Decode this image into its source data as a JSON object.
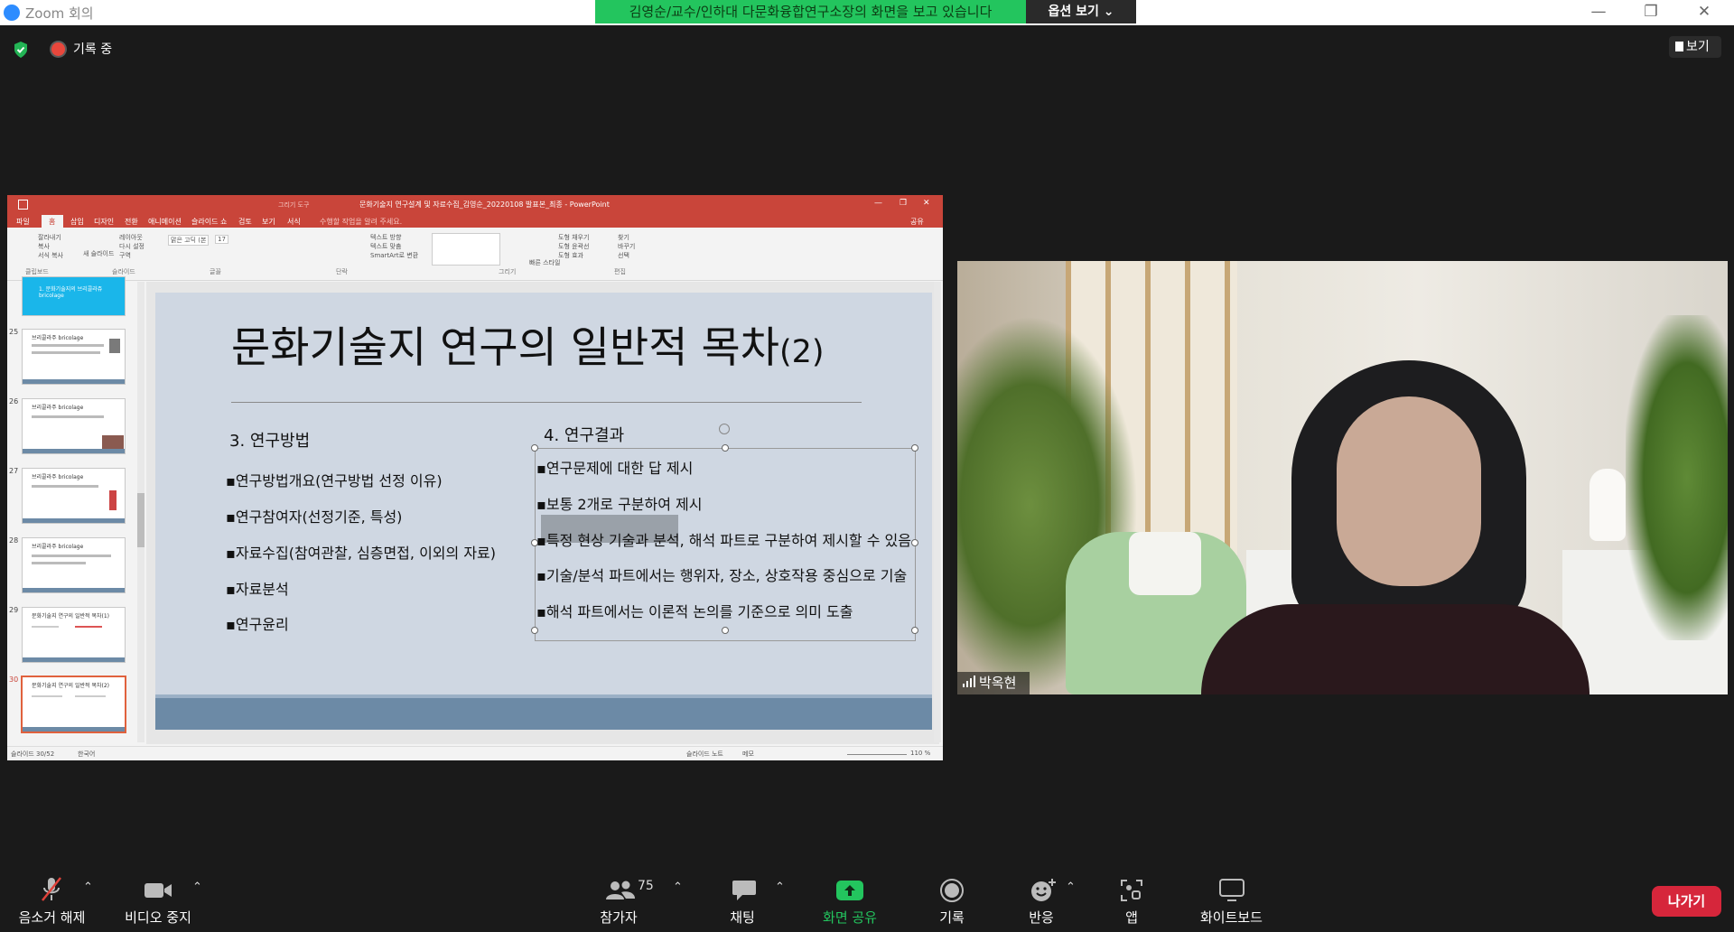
{
  "window": {
    "app_title": "Zoom 회의",
    "share_banner": "김영순/교수/인하대 다문화융합연구소장의 화면을 보고 있습니다",
    "view_options": "옵션 보기 ⌄",
    "minimize": "—",
    "restore": "❐",
    "close": "✕"
  },
  "meeting_bar": {
    "recording_label": "기록 중",
    "view_button": "보기"
  },
  "powerpoint": {
    "title": "문화기술지 연구설계 및 자료수집_김영순_20220108 발표본_최종 - PowerPoint",
    "menu": [
      "파일",
      "홈",
      "삽입",
      "디자인",
      "전환",
      "애니메이션",
      "슬라이드 쇼",
      "검토",
      "보기",
      "서식"
    ],
    "drawing_tools": "그리기 도구",
    "tell_me": "수행할 작업을 알려 주세요.",
    "share": "공유",
    "ribbon_groups": [
      "클립보드",
      "슬라이드",
      "글꼴",
      "단락",
      "그리기",
      "편집"
    ],
    "ribbon_items": [
      "잘라내기",
      "복사",
      "서식 복사",
      "새 슬라이드",
      "레이아웃",
      "다시 설정",
      "구역",
      "맑은 고딕 (본",
      "17",
      "텍스트 방향",
      "텍스트 맞춤",
      "SmartArt로 변환",
      "빠른 스타일",
      "도형 채우기",
      "도형 윤곽선",
      "도형 효과",
      "찾기",
      "바꾸기",
      "선택"
    ],
    "thumbnails": [
      {
        "num": "",
        "title": "1. 문화기술지의 브리콜라쥬 bricolage",
        "selected": false
      },
      {
        "num": "25",
        "title": "브리콜라주 bricolage",
        "selected": false
      },
      {
        "num": "26",
        "title": "브리콜라주 bricolage",
        "selected": false
      },
      {
        "num": "27",
        "title": "브리콜라주 bricolage",
        "selected": false
      },
      {
        "num": "28",
        "title": "브리콜라주 bricolage",
        "selected": false
      },
      {
        "num": "29",
        "title": "문화기술지 연구의 일반적 목차(1)",
        "selected": false
      },
      {
        "num": "30",
        "title": "문화기술지 연구의 일반적 목차(2)",
        "selected": true
      }
    ],
    "slide": {
      "title": "문화기술지 연구의 일반적 목차",
      "title_suffix": "(2)",
      "left_heading": "3. 연구방법",
      "left_items": [
        "연구방법개요(연구방법 선정 이유)",
        "연구참여자(선정기준, 특성)",
        "자료수집(참여관찰, 심층면접, 이외의 자료)",
        "자료분석",
        "연구윤리"
      ],
      "right_heading": "4. 연구결과",
      "right_items": [
        "연구문제에 대한 답 제시",
        "보통 2개로 구분하여 제시",
        "특정 현상 기술과 분석, 해석 파트로 구분하여 제시할 수 있음",
        "기술/분석 파트에서는 행위자, 장소, 상호작용 중심으로 기술",
        "해석 파트에서는 이론적 논의를 기준으로 의미 도출"
      ]
    },
    "status": {
      "slide_count": "슬라이드 30/52",
      "language": "한국어",
      "notes": "슬라이드 노트",
      "comments": "메모",
      "zoom": "110 %"
    }
  },
  "video": {
    "participant_name": "박옥현"
  },
  "toolbar": {
    "unmute": "음소거 해제",
    "stop_video": "비디오 중지",
    "participants": "참가자",
    "participant_count": "75",
    "chat": "채팅",
    "share_screen": "화면 공유",
    "record": "기록",
    "reactions": "반응",
    "apps": "앱",
    "whiteboard": "화이트보드",
    "leave": "나가기"
  },
  "colors": {
    "share_green": "#23c55e",
    "ppt_red": "#c9453a",
    "leave_red": "#d6263b",
    "slide_bg": "#cfd7e2",
    "slide_band": "#6c8aa6"
  }
}
